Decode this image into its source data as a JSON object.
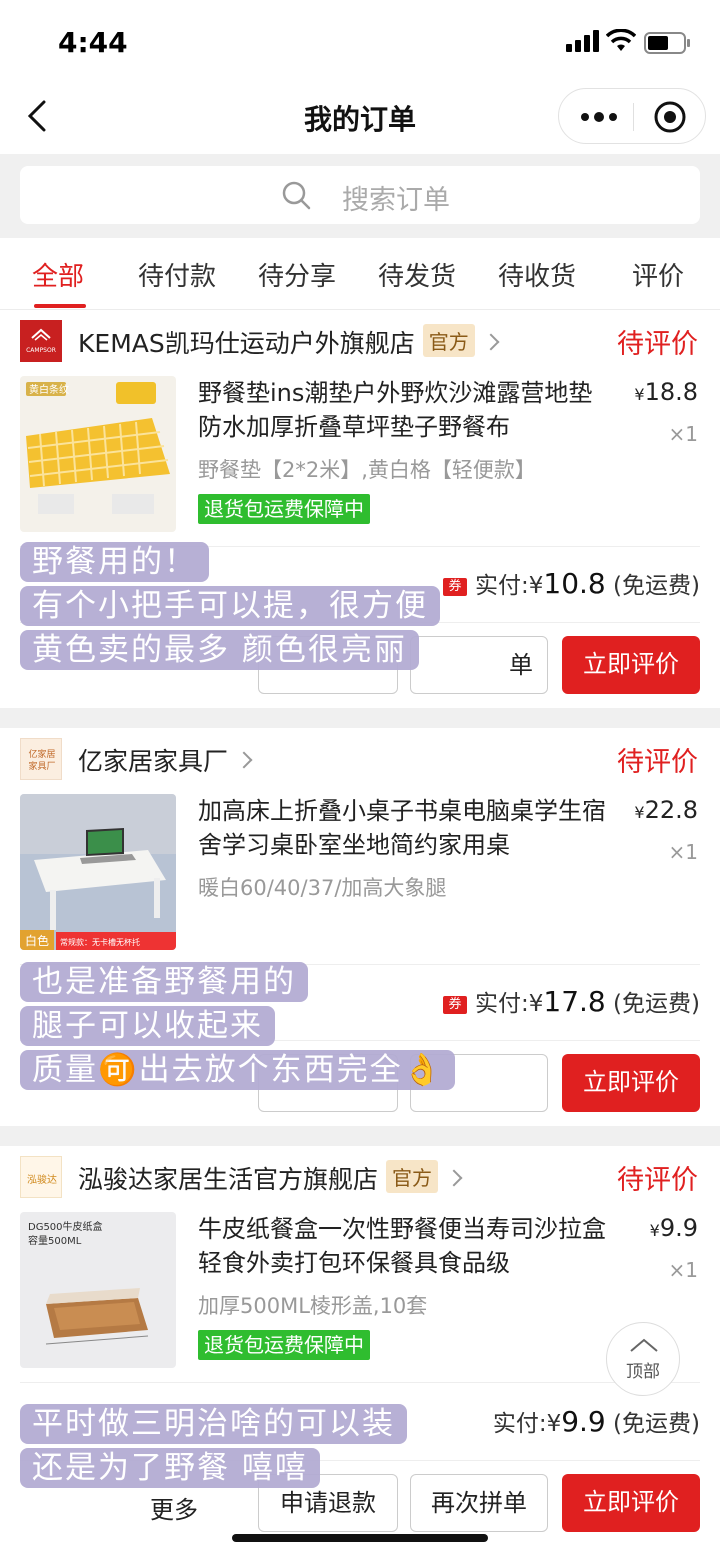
{
  "status_bar": {
    "time": "4:44"
  },
  "nav": {
    "title": "我的订单"
  },
  "search": {
    "placeholder": "搜索订单"
  },
  "tabs": [
    "全部",
    "待付款",
    "待分享",
    "待发货",
    "待收货",
    "评价"
  ],
  "orders": [
    {
      "shop": "KEMAS凯玛仕运动户外旗舰店",
      "badge": "官方",
      "logo_text": "CAMPSOR",
      "status": "待评价",
      "title": "野餐垫ins潮垫户外野炊沙滩露营地垫防水加厚折叠草坪垫子野餐布",
      "thumb_text": "黄白条纹",
      "price": "18.8",
      "qty": "×1",
      "spec": "野餐垫【2*2米】,黄白格【轻便款】",
      "guarantee": "退货包运费保障中",
      "coupon": "券",
      "paid_label": "实付:",
      "paid": "10.8",
      "shipping": "(免运费)",
      "button_partial": "单",
      "review_button": "立即评价"
    },
    {
      "shop": "亿家居家具厂",
      "logo_text": "亿家居家具厂",
      "status": "待评价",
      "title": "加高床上折叠小桌子书桌电脑桌学生宿舍学习桌卧室坐地简约家用桌",
      "thumb_text": "白色",
      "thumb_subtext": "常规款：无卡槽无杯托",
      "price": "22.8",
      "qty": "×1",
      "spec": "暖白60/40/37/加高大象腿",
      "coupon": "券",
      "paid_label": "实付:",
      "paid": "17.8",
      "shipping": "(免运费)",
      "review_button": "立即评价"
    },
    {
      "shop": "泓骏达家居生活官方旗舰店",
      "badge": "官方",
      "logo_text": "泓骏达",
      "status": "待评价",
      "title": "牛皮纸餐盒一次性野餐便当寿司沙拉盒轻食外卖打包环保餐具食品级",
      "thumb_text": "DG500牛皮纸盒",
      "thumb_subtext": "容量500ML",
      "price": "9.9",
      "qty": "×1",
      "spec": "加厚500ML棱形盖,10套",
      "guarantee": "退货包运费保障中",
      "paid_label": "实付:",
      "paid": "9.9",
      "shipping": "(免运费)",
      "more": "更多",
      "refund_button": "申请退款",
      "reorder_button": "再次拼单",
      "review_button": "立即评价"
    }
  ],
  "notes": [
    [
      "野餐用的！",
      "有个小把手可以提，很方便",
      "黄色卖的最多 颜色很亮丽"
    ],
    [
      "也是准备野餐用的",
      "腿子可以收起来",
      "质量🉑出去放个东西完全👌"
    ],
    [
      "平时做三明治啥的可以装",
      "还是为了野餐 嘻嘻"
    ]
  ],
  "currency": "¥",
  "back_to_top": "顶部",
  "colors": {
    "accent": "#e02020",
    "guarantee": "#2fbd2f",
    "note_bg": "#b2aad2"
  }
}
